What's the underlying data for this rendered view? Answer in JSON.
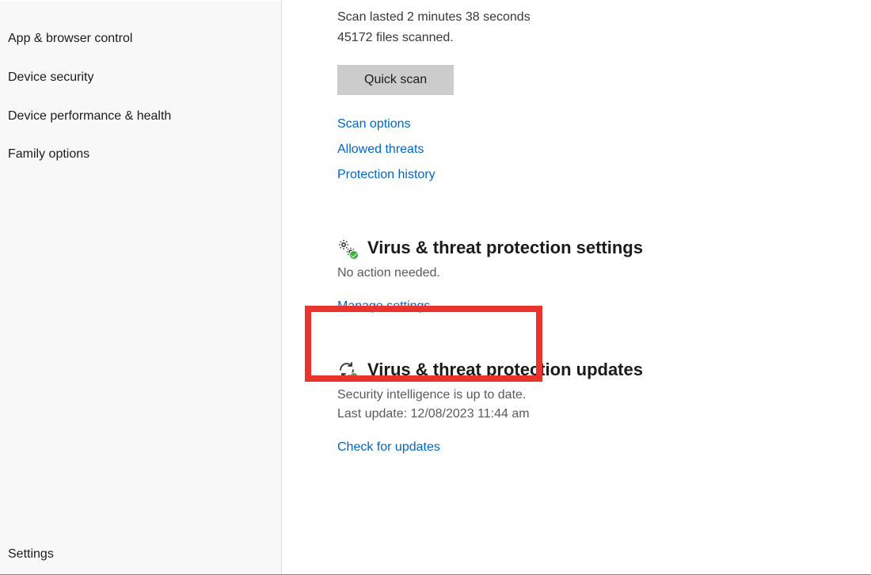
{
  "sidebar": {
    "items": [
      "App & browser control",
      "Device security",
      "Device performance & health",
      "Family options"
    ],
    "footer": "Settings"
  },
  "scan": {
    "duration_line": "Scan lasted 2 minutes 38 seconds",
    "files_line": "45172 files scanned.",
    "quick_scan_label": "Quick scan",
    "links": {
      "scan_options": "Scan options",
      "allowed_threats": "Allowed threats",
      "protection_history": "Protection history"
    }
  },
  "settings_section": {
    "title": "Virus & threat protection settings",
    "status": "No action needed.",
    "manage_link": "Manage settings"
  },
  "updates_section": {
    "title": "Virus & threat protection updates",
    "status": "Security intelligence is up to date.",
    "last_update": "Last update: 12/08/2023 11:44 am",
    "check_link": "Check for updates"
  }
}
